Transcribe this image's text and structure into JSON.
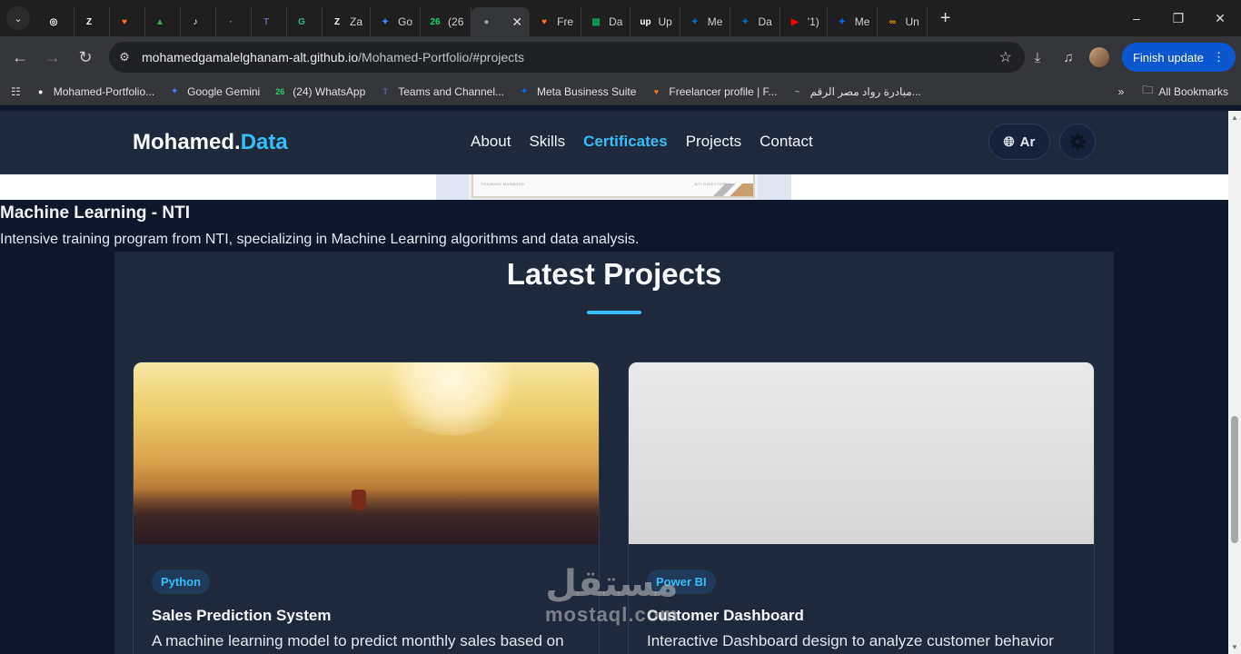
{
  "browser": {
    "tabs": [
      {
        "icon": "openai-icon",
        "label": "",
        "color": "#ffffff"
      },
      {
        "icon": "zotero-icon",
        "label": "",
        "color": "#ffffff"
      },
      {
        "icon": "freelancer-icon",
        "label": "",
        "color": "#f97316"
      },
      {
        "icon": "drive-icon",
        "label": "",
        "color": "#34a853"
      },
      {
        "icon": "audio-icon",
        "label": "",
        "color": "#ffffff"
      },
      {
        "icon": "blank-icon",
        "label": "",
        "color": "#888888"
      },
      {
        "icon": "teams-icon",
        "label": "",
        "color": "#6264a7"
      },
      {
        "icon": "grammarly-icon",
        "label": "",
        "color": "#15c39a"
      },
      {
        "icon": "zotero-icon",
        "label": "Za",
        "color": "#ffffff"
      },
      {
        "icon": "gemini-icon",
        "label": "Go",
        "color": "#4285f4"
      },
      {
        "icon": "whatsapp-icon",
        "label": "(26",
        "color": "#25d366"
      },
      {
        "icon": "globe-icon",
        "label": "",
        "color": "#9aa0a6",
        "active": true
      },
      {
        "icon": "freelancer-icon",
        "label": "Fre",
        "color": "#f97316"
      },
      {
        "icon": "sheets-icon",
        "label": "Da",
        "color": "#0f9d58"
      },
      {
        "icon": "upwork-icon",
        "label": "Up",
        "color": "#ffffff"
      },
      {
        "icon": "meta-icon",
        "label": "Me",
        "color": "#0a66c2"
      },
      {
        "icon": "meta-icon",
        "label": "Da",
        "color": "#0a66c2"
      },
      {
        "icon": "youtube-icon",
        "label": "'1)",
        "color": "#ff0000"
      },
      {
        "icon": "meta-icon",
        "label": "Me",
        "color": "#0866ff"
      },
      {
        "icon": "infinity-icon",
        "label": "Un",
        "color": "#f59e0b"
      }
    ],
    "url_host": "mohamedgamalelghanam-alt.github.io",
    "url_path": "/Mohamed-Portfolio/#projects",
    "update_label": "Finish update",
    "bookmarks": [
      {
        "icon": "github-icon",
        "label": "Mohamed-Portfolio...",
        "color": "#ffffff"
      },
      {
        "icon": "gemini-icon",
        "label": "Google Gemini",
        "color": "#4285f4"
      },
      {
        "icon": "whatsapp-icon",
        "label": "(24) WhatsApp",
        "color": "#25d366"
      },
      {
        "icon": "teams-icon",
        "label": "Teams and Channel...",
        "color": "#6264a7"
      },
      {
        "icon": "meta-icon",
        "label": "Meta Business Suite",
        "color": "#0866ff"
      },
      {
        "icon": "freelancer-icon",
        "label": "Freelancer profile | F...",
        "color": "#f97316"
      },
      {
        "icon": "digital-egypt-icon",
        "label": "مبادرة رواد مصر الرقم...",
        "color": "#9aa0a6"
      }
    ],
    "all_bookmarks_label": "All Bookmarks"
  },
  "site": {
    "brand_main": "Mohamed.",
    "brand_accent": "Data",
    "menu": [
      "About",
      "Skills",
      "Certificates",
      "Projects",
      "Contact"
    ],
    "active_menu_index": 2,
    "lang_label": "Ar",
    "accent_color": "#38bdf8"
  },
  "certificate": {
    "image_caption_left": "TRAINING MANAGER",
    "image_caption_right": "NTI DIRECTOR",
    "title": "Machine Learning - NTI",
    "description": "Intensive training program from NTI, specializing in Machine Learning algorithms and data analysis."
  },
  "projects": {
    "heading": "Latest Projects",
    "cards": [
      {
        "tag": "Python",
        "title": "Sales Prediction System",
        "description": "A machine learning model to predict monthly sales based on"
      },
      {
        "tag": "Power BI",
        "title": "Customer Dashboard",
        "description": "Interactive Dashboard design to analyze customer behavior"
      }
    ]
  },
  "watermark": {
    "arabic": "مستقل",
    "latin": "mostaql.com"
  }
}
